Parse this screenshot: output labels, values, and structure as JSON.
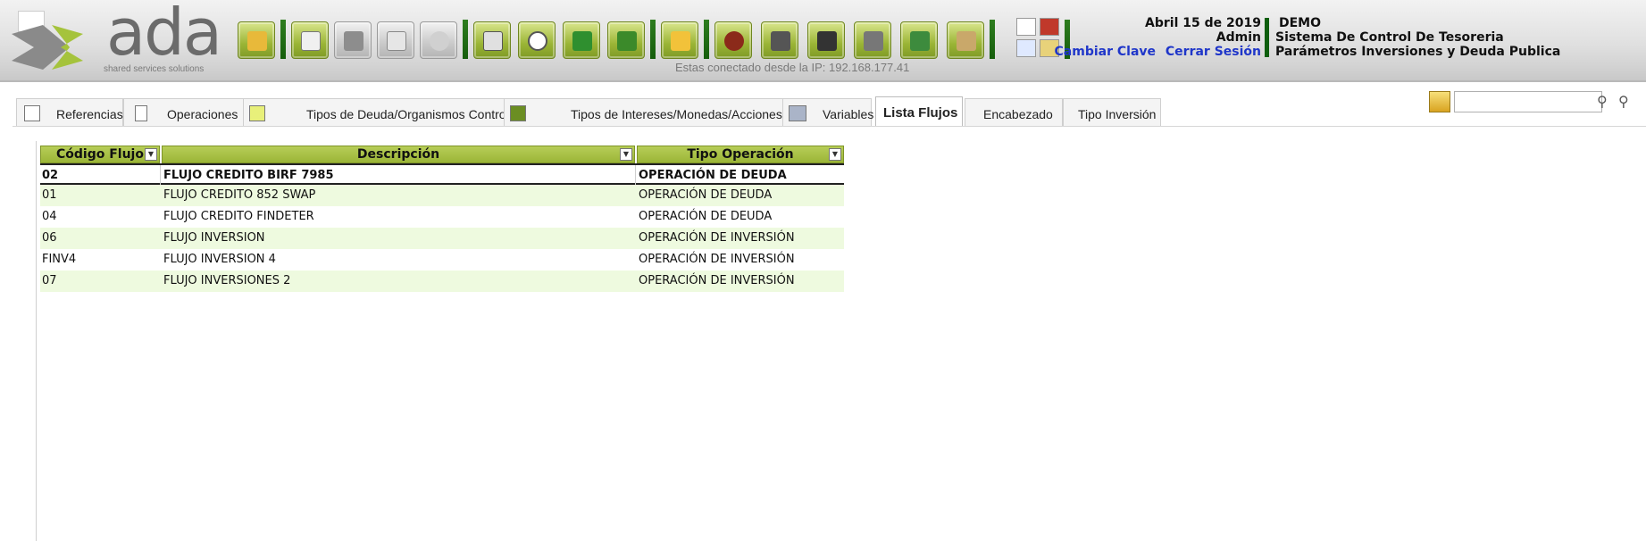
{
  "header": {
    "logo_text": "ada",
    "logo_tagline": "shared services solutions",
    "ip_text": "Estas conectado desde la IP: 192.168.177.41",
    "date": "Abril 15 de 2019",
    "user": "Admin",
    "change_password": "Cambiar Clave",
    "logout": "Cerrar Sesión",
    "company": "DEMO",
    "system": "Sistema De Control De Tesoreria",
    "module": "Parámetros Inversiones y Deuda Publica"
  },
  "toolbar": {
    "buttons": [
      "folder-open-icon",
      "new-document-icon",
      "save-icon",
      "delete-icon",
      "undo-icon",
      "print-icon",
      "search-icon",
      "export-excel-icon",
      "import-icon",
      "lock-icon",
      "money-bag-icon",
      "camera-icon",
      "grid-icon",
      "cart-icon",
      "approve-icon",
      "users-icon"
    ],
    "accent": "#9bb536",
    "separator_color": "#155d0c"
  },
  "tabs": [
    {
      "label": "Referencias",
      "icon": "list-icon"
    },
    {
      "label": "Operaciones",
      "icon": "document-icon"
    },
    {
      "label": "Tipos de Deuda/Organismos Control",
      "icon": "note-icon"
    },
    {
      "label": "Tipos de Intereses/Monedas/Acciones",
      "icon": "clapper-icon"
    },
    {
      "label": "Variables",
      "icon": "variables-icon"
    },
    {
      "label": "Lista Flujos",
      "active": true
    },
    {
      "label": "Encabezado"
    },
    {
      "label": "Tipo Inversión"
    }
  ],
  "search": {
    "value": "",
    "placeholder": ""
  },
  "grid": {
    "columns": [
      "Código Flujo",
      "Descripción",
      "Tipo Operación"
    ],
    "rows": [
      {
        "code": "02",
        "desc": "FLUJO CREDITO BIRF 7985",
        "type": "OPERACIÓN DE DEUDA"
      },
      {
        "code": "01",
        "desc": "FLUJO CREDITO 852 SWAP",
        "type": "OPERACIÓN DE DEUDA"
      },
      {
        "code": "04",
        "desc": "FLUJO CREDITO FINDETER",
        "type": "OPERACIÓN DE DEUDA"
      },
      {
        "code": "06",
        "desc": "FLUJO INVERSION",
        "type": "OPERACIÓN DE INVERSIÓN"
      },
      {
        "code": "FINV4",
        "desc": "FLUJO INVERSION 4",
        "type": "OPERACIÓN DE INVERSIÓN"
      },
      {
        "code": "07",
        "desc": "FLUJO INVERSIONES 2",
        "type": "OPERACIÓN DE INVERSIÓN"
      }
    ],
    "header_color": "#9bb537",
    "alt_row_color": "#eefadf"
  }
}
